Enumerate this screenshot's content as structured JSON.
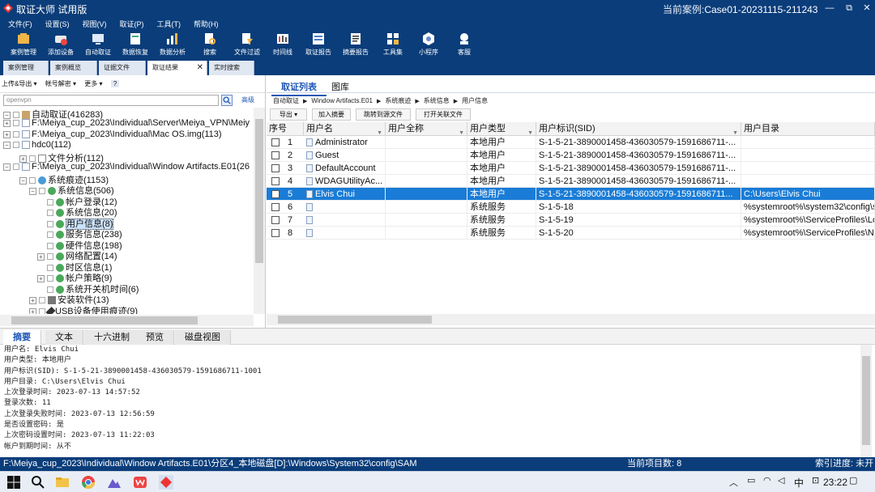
{
  "window": {
    "title": "取证大师 试用版",
    "case_label": "当前案例:",
    "case_name": "Case01-20231115-211243",
    "minimize": "—",
    "restore": "⧉",
    "close": "✕"
  },
  "menu": [
    "文件(F)",
    "设置(S)",
    "视图(V)",
    "取证(P)",
    "工具(T)",
    "帮助(H)"
  ],
  "toolbar": [
    {
      "label": "案例管理",
      "icon": "case-manage-icon"
    },
    {
      "label": "添加设备",
      "icon": "add-device-icon"
    },
    {
      "label": "自动取证",
      "icon": "auto-forensics-icon"
    },
    {
      "label": "数据恢复",
      "icon": "data-recovery-icon"
    },
    {
      "label": "数据分析",
      "icon": "data-analysis-icon"
    },
    {
      "label": "搜索",
      "icon": "search-doc-icon"
    },
    {
      "label": "文件过滤",
      "icon": "file-filter-icon"
    },
    {
      "label": "时间线",
      "icon": "timeline-icon"
    },
    {
      "label": "取证报告",
      "icon": "forensic-report-icon"
    },
    {
      "label": "摘要报告",
      "icon": "summary-report-icon"
    },
    {
      "label": "工具集",
      "icon": "toolset-icon"
    },
    {
      "label": "小程序",
      "icon": "mini-program-icon"
    },
    {
      "label": "客服",
      "icon": "customer-service-icon"
    }
  ],
  "doc_tabs": [
    {
      "label": "案例管理"
    },
    {
      "label": "案例概览"
    },
    {
      "label": "证据文件"
    },
    {
      "label": "取证结果",
      "active": true,
      "close": "✕"
    },
    {
      "label": "实时搜索"
    }
  ],
  "left": {
    "toolbar": [
      "上传&导出 ▾",
      "帐号解密 ▾",
      "更多 ▾",
      "?"
    ],
    "search_placeholder": "openvpn",
    "advanced": "高级",
    "tree": [
      {
        "label": "自动取证(416283)"
      },
      {
        "label": "F:\\Meiya_cup_2023\\Individual\\Server\\Meiya_VPN\\Meiy"
      },
      {
        "label": "F:\\Meiya_cup_2023\\Individual\\Mac OS.img(113)"
      },
      {
        "label": "hdc0(112)"
      },
      {
        "label": "文件分析(112)"
      },
      {
        "label": "F:\\Meiya_cup_2023\\Individual\\Window Artifacts.E01(26"
      },
      {
        "label": "系统痕迹(1153)"
      },
      {
        "label": "系统信息(506)"
      },
      {
        "label": "帐户登录(12)"
      },
      {
        "label": "系统信息(20)"
      },
      {
        "label": "用户信息(8)"
      },
      {
        "label": "服务信息(238)"
      },
      {
        "label": "硬件信息(198)"
      },
      {
        "label": "网络配置(14)"
      },
      {
        "label": "时区信息(1)"
      },
      {
        "label": "帐户策略(9)"
      },
      {
        "label": "系统开关机时间(6)"
      },
      {
        "label": "安装软件(13)"
      },
      {
        "label": "USB设备使用痕迹(9)"
      }
    ]
  },
  "right": {
    "tabs": [
      "取证列表",
      "图库"
    ],
    "breadcrumb": [
      "自动取证",
      "Window Artifacts.E01",
      "系统痕迹",
      "系统信息",
      "用户信息"
    ],
    "actions": [
      "导出  ▾",
      "加入摘要",
      "跳转到源文件",
      "打开关联文件"
    ],
    "columns": [
      "序号",
      "用户名",
      "用户全称",
      "用户类型",
      "用户标识(SID)",
      "用户目录"
    ],
    "rows": [
      {
        "n": "1",
        "name": "Administrator",
        "full": "",
        "type": "本地用户",
        "sid": "S-1-5-21-3890001458-436030579-1591686711-...",
        "dir": ""
      },
      {
        "n": "2",
        "name": "Guest",
        "full": "",
        "type": "本地用户",
        "sid": "S-1-5-21-3890001458-436030579-1591686711-...",
        "dir": ""
      },
      {
        "n": "3",
        "name": "DefaultAccount",
        "full": "",
        "type": "本地用户",
        "sid": "S-1-5-21-3890001458-436030579-1591686711-...",
        "dir": ""
      },
      {
        "n": "4",
        "name": "WDAGUtilityAc...",
        "full": "",
        "type": "本地用户",
        "sid": "S-1-5-21-3890001458-436030579-1591686711-...",
        "dir": ""
      },
      {
        "n": "5",
        "name": "Elvis Chui",
        "full": "",
        "type": "本地用户",
        "sid": "S-1-5-21-3890001458-436030579-1591686711...",
        "dir": "C:\\Users\\Elvis Chui",
        "selected": true
      },
      {
        "n": "6",
        "name": "",
        "full": "",
        "type": "系统服务",
        "sid": "S-1-5-18",
        "dir": "%systemroot%\\system32\\config\\s"
      },
      {
        "n": "7",
        "name": "",
        "full": "",
        "type": "系统服务",
        "sid": "S-1-5-19",
        "dir": "%systemroot%\\ServiceProfiles\\Loc"
      },
      {
        "n": "8",
        "name": "",
        "full": "",
        "type": "系统服务",
        "sid": "S-1-5-20",
        "dir": "%systemroot%\\ServiceProfiles\\Ne"
      }
    ]
  },
  "bottom": {
    "tabs": [
      "摘要",
      "文本",
      "十六进制",
      "预览",
      "磁盘视图"
    ],
    "lines": [
      "用户名: Elvis Chui",
      "用户类型: 本地用户",
      "用户标识(SID): S-1-5-21-3890001458-436030579-1591686711-1001",
      "用户目录: C:\\Users\\Elvis Chui",
      "上次登录时间: 2023-07-13 14:57:52",
      "登录次数: 11",
      "上次登录失败时间: 2023-07-13 12:56:59",
      "是否设置密码: 是",
      "上次密码设置时间: 2023-07-13 11:22:03",
      "帐户到期时间: 从不"
    ]
  },
  "status": {
    "path": "F:\\Meiya_cup_2023\\Individual\\Window Artifacts.E01\\分区4_本地磁盘[D]:\\Windows\\System32\\config\\SAM",
    "count": "当前项目数: 8",
    "progress": "索引进度: 未开始"
  },
  "taskbar": {
    "time": "23:22",
    "ime": "中"
  },
  "colors": {
    "accent": "#0a3d7a",
    "selection": "#1a7cd6",
    "link": "#1f57b5"
  }
}
